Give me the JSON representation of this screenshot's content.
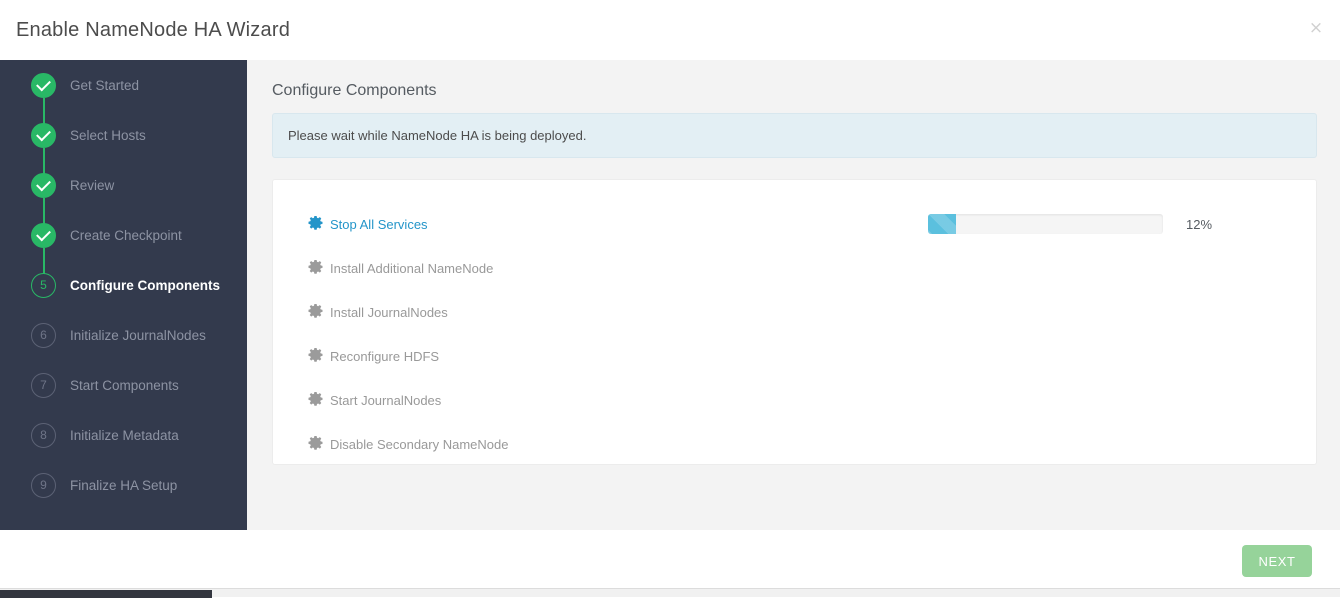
{
  "header": {
    "title": "Enable NameNode HA Wizard",
    "close_label": "×"
  },
  "sidebar": {
    "steps": [
      {
        "num": "1",
        "label": "Get Started",
        "state": "done"
      },
      {
        "num": "2",
        "label": "Select Hosts",
        "state": "done"
      },
      {
        "num": "3",
        "label": "Review",
        "state": "done"
      },
      {
        "num": "4",
        "label": "Create Checkpoint",
        "state": "done"
      },
      {
        "num": "5",
        "label": "Configure Components",
        "state": "current"
      },
      {
        "num": "6",
        "label": "Initialize JournalNodes",
        "state": "pending"
      },
      {
        "num": "7",
        "label": "Start Components",
        "state": "pending"
      },
      {
        "num": "8",
        "label": "Initialize Metadata",
        "state": "pending"
      },
      {
        "num": "9",
        "label": "Finalize HA Setup",
        "state": "pending"
      }
    ]
  },
  "content": {
    "title": "Configure Components",
    "alert_message": "Please wait while NameNode HA is being deployed.",
    "tasks": [
      {
        "name": "Stop All Services",
        "state": "active",
        "progress": 12,
        "progress_label": "12%"
      },
      {
        "name": "Install Additional NameNode",
        "state": "pending",
        "progress": null,
        "progress_label": ""
      },
      {
        "name": "Install JournalNodes",
        "state": "pending",
        "progress": null,
        "progress_label": ""
      },
      {
        "name": "Reconfigure HDFS",
        "state": "pending",
        "progress": null,
        "progress_label": ""
      },
      {
        "name": "Start JournalNodes",
        "state": "pending",
        "progress": null,
        "progress_label": ""
      },
      {
        "name": "Disable Secondary NameNode",
        "state": "pending",
        "progress": null,
        "progress_label": ""
      }
    ]
  },
  "footer": {
    "next_label": "NEXT"
  },
  "colors": {
    "sidebar_bg": "#333a4d",
    "step_done": "#29b866",
    "step_current": "#29b866",
    "step_pending": "#5c6275",
    "link_blue": "#2495c9",
    "progress_fill": "#5bc0de",
    "alert_bg": "#e3eff4",
    "next_button": "#96d39a"
  }
}
